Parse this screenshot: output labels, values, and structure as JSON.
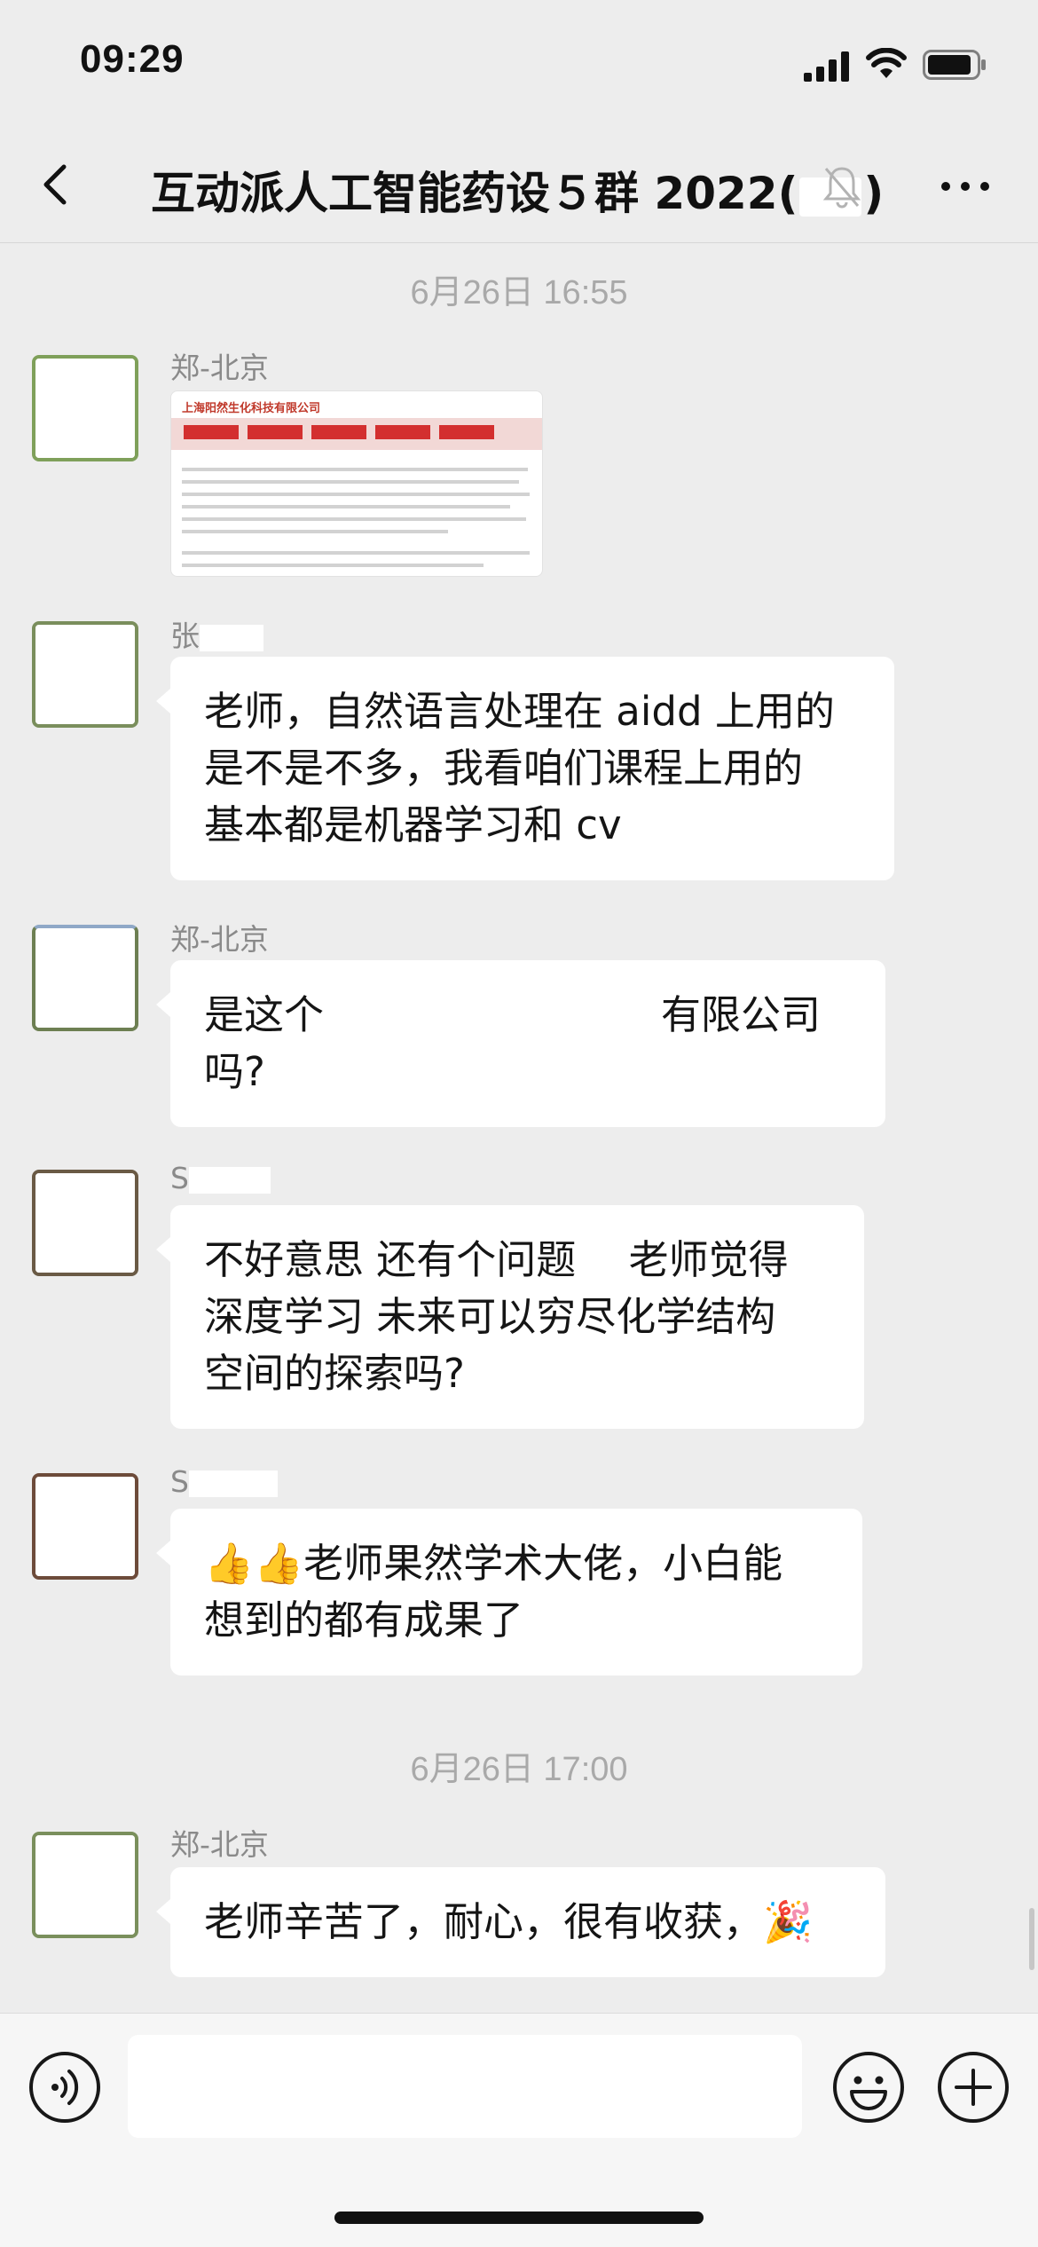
{
  "status_bar": {
    "time": "09:29"
  },
  "nav": {
    "title_prefix": "互动派人工智能药设５群 2022(",
    "title_suffix": ")"
  },
  "timestamps": [
    "6月26日 16:55",
    "6月26日 17:00"
  ],
  "doc_card": {
    "company": "上海阳然生化科技有限公司"
  },
  "messages": [
    {
      "sender": "郑-北京",
      "type": "document"
    },
    {
      "sender": "张",
      "text": [
        "老师，自然语言处理在 aidd 上用的",
        "是不是不多，我看咱们课程上用的",
        "基本都是机器学习和 cv"
      ]
    },
    {
      "sender": "郑-北京",
      "text": [
        "是这个",
        "有限公司",
        "吗?"
      ]
    },
    {
      "sender": "S",
      "text": [
        "不好意思 还有个问题　 老师觉得",
        "深度学习 未来可以穷尽化学结构",
        "空间的探索吗?"
      ]
    },
    {
      "sender": "S",
      "text": [
        "老师果然学术大佬，小白能",
        "想到的都有成果了"
      ],
      "emoji_prefix": "👍👍"
    },
    {
      "sender": "郑-北京",
      "text": [
        "老师辛苦了，耐心，很有收获，🎉"
      ]
    }
  ],
  "colors": {
    "background": "#ededed",
    "bubble": "#ffffff",
    "timestamp": "#a9a9a9",
    "sender": "#8a8a8a"
  },
  "icons": [
    "back-chevron-icon",
    "mute-bell-icon",
    "more-dots-icon",
    "voice-icon",
    "emoji-icon",
    "plus-icon"
  ]
}
